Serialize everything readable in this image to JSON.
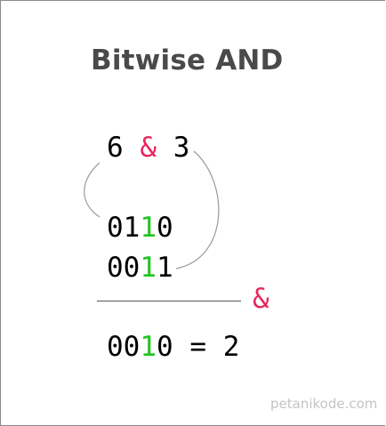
{
  "title": "Bitwise AND",
  "expression": {
    "left": "6",
    "operator": "&",
    "right": "3"
  },
  "operand1_bits": [
    "0",
    "1",
    "1",
    "0"
  ],
  "operand2_bits": [
    "0",
    "0",
    "1",
    "1"
  ],
  "operator_symbol": "&",
  "result": {
    "bits": [
      "0",
      "0",
      "1",
      "0"
    ],
    "equals": "=",
    "decimal": "2"
  },
  "highlight_color": "#1ec41e",
  "operator_color": "#e8245e",
  "watermark": "petanikode.com"
}
